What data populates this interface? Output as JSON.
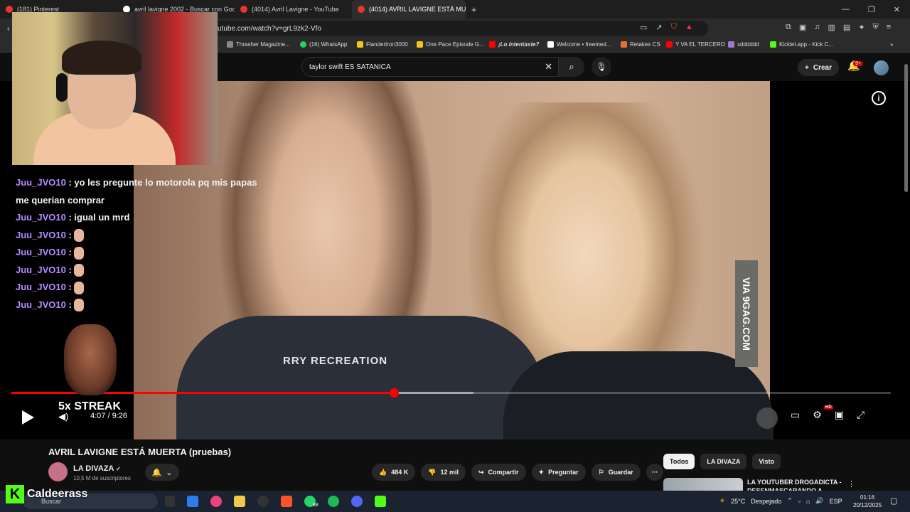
{
  "browser": {
    "tabs": [
      {
        "label": "(181) Pinterest",
        "active": false
      },
      {
        "label": "avril lavigne 2002 - Buscar con Goog",
        "active": false
      },
      {
        "label": "(4014) Avril Lavigne - YouTube",
        "active": false
      },
      {
        "label": "(4014) AVRIL LAVIGNE ESTÁ MU",
        "active": true
      }
    ],
    "new_tab": "+",
    "url": "utube.com/watch?v=grL9zk2-Vfo",
    "bookmarks": [
      {
        "label": "Thrasher Magazine..."
      },
      {
        "label": "(16) WhatsApp"
      },
      {
        "label": "Flandertron3000"
      },
      {
        "label": "One Pace Episode G..."
      },
      {
        "label": "¡Lo intentaste?"
      },
      {
        "label": "Welcome • freemed..."
      },
      {
        "label": "Retakes CS"
      },
      {
        "label": "Y VA EL TERCERO"
      },
      {
        "label": "xdddddd"
      },
      {
        "label": "Kicklet.app - Kick C..."
      }
    ]
  },
  "youtube": {
    "search_value": "taylor swift ES SATANICA",
    "create_label": "Crear",
    "notif_badge": "9+"
  },
  "video": {
    "watermark": "VIA 9GAG.COM",
    "shirt_text": "RRY RECREATION",
    "time_display": "4:07 / 9:26",
    "progress": 0.435,
    "hd_badge": "HD",
    "title": "AVRIL LAVIGNE ESTÁ MUERTA (pruebas)",
    "channel": "LA DIVAZA",
    "subscribers": "10,5 M de suscriptores",
    "likes": "484 K",
    "dislikes": "12 mil",
    "share": "Compartir",
    "ask": "Preguntar",
    "save": "Guardar"
  },
  "stream_overlay": {
    "chat": [
      {
        "user": "Juu_JVO10",
        "text": ": yo les pregunte lo motorola pq mis papas me querian comprar"
      },
      {
        "user": "Juu_JVO10",
        "text": ": igual un mrd"
      },
      {
        "user": "Juu_JVO10",
        "text": ":"
      },
      {
        "user": "Juu_JVO10",
        "text": ":"
      },
      {
        "user": "Juu_JVO10",
        "text": ":"
      },
      {
        "user": "Juu_JVO10",
        "text": ":"
      },
      {
        "user": "Juu_JVO10",
        "text": ":"
      }
    ],
    "streak": "5x STREAK",
    "kick_name": "Caldeerass"
  },
  "sidebar": {
    "chips": [
      "Todos",
      "LA DIVAZA",
      "Visto"
    ],
    "rec_title": "LA YOUTUBER DROGADICTA - DESENMASCARANDO A"
  },
  "taskbar": {
    "search_placeholder": "Buscar",
    "weather": "25°C",
    "weather_desc": "Despejado",
    "lang": "ESP",
    "time": "01:16",
    "date": "20/12/2025",
    "whatsapp_badge": "88"
  },
  "colors": {
    "accent": "#ff0000",
    "chat_user": "#b48cff",
    "kick": "#53fc18"
  }
}
